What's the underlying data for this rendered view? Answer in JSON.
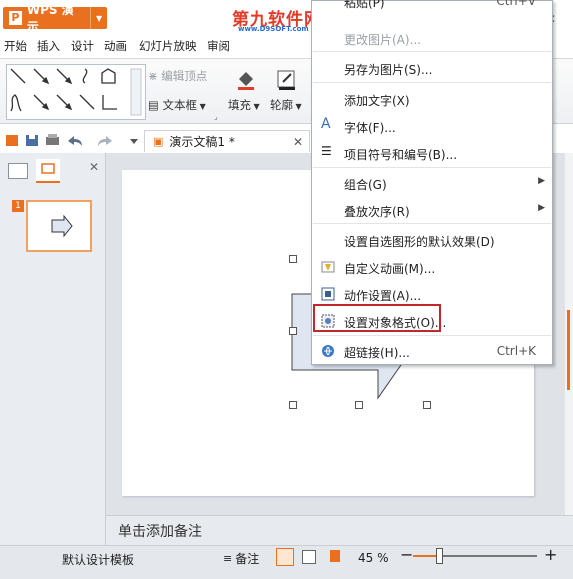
{
  "app": {
    "name": "WPS 演示",
    "logo_letter": "P"
  },
  "watermark": {
    "site_logo": "第九软件网",
    "site_url": "www.D9SOFT.com"
  },
  "menu_tabs": [
    "开始",
    "插入",
    "设计",
    "动画",
    "幻灯片放映",
    "审阅"
  ],
  "ribbon": {
    "edit_vertex": "编辑顶点",
    "textbox": "文本框",
    "fill": "填充",
    "outline": "轮廓"
  },
  "document": {
    "tab_title": "演示文稿1 *",
    "slide_number": "1"
  },
  "notes_placeholder": "单击添加备注",
  "status": {
    "template": "默认设计模板",
    "notes_label": "备注",
    "zoom": "45 %",
    "zoom_out": "−",
    "zoom_in": "+",
    "zoom_level": 0.2
  },
  "context_menu": {
    "items": [
      {
        "label": "粘贴(P)",
        "shortcut": "Ctrl+V",
        "disabled": false
      },
      {
        "label": "更改图片(A)...",
        "shortcut": "",
        "disabled": true
      },
      {
        "label": "另存为图片(S)...",
        "shortcut": ""
      },
      {
        "label": "添加文字(X)",
        "shortcut": ""
      },
      {
        "label": "字体(F)...",
        "shortcut": "",
        "icon": "font-icon"
      },
      {
        "label": "项目符号和编号(B)...",
        "shortcut": "",
        "icon": "bullet-list-icon"
      },
      {
        "label": "组合(G)",
        "submenu": true
      },
      {
        "label": "叠放次序(R)",
        "submenu": true
      },
      {
        "label": "设置自选图形的默认效果(D)",
        "shortcut": ""
      },
      {
        "label": "自定义动画(M)...",
        "shortcut": "",
        "icon": "custom-animation-icon"
      },
      {
        "label": "动作设置(A)...",
        "shortcut": "",
        "icon": "action-settings-icon"
      },
      {
        "label": "设置对象格式(O)...",
        "shortcut": "",
        "icon": "format-object-icon",
        "highlighted": true
      },
      {
        "label": "超链接(H)...",
        "shortcut": "Ctrl+K",
        "icon": "hyperlink-icon"
      }
    ]
  },
  "colors": {
    "accent": "#e8701e",
    "highlight": "#c0282e",
    "link": "#2a6ad2"
  }
}
